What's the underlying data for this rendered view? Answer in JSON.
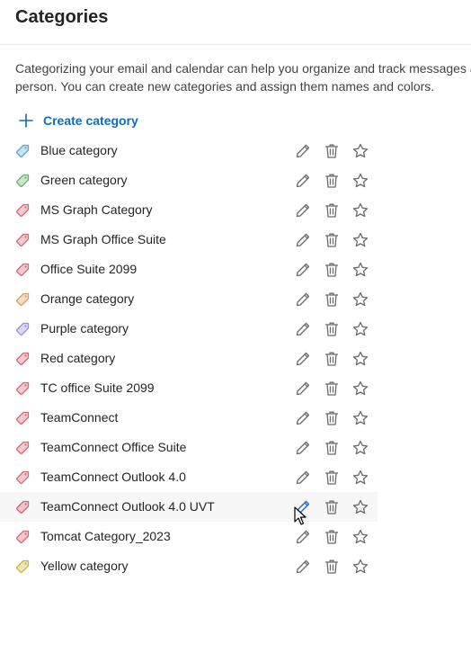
{
  "header": {
    "title": "Categories"
  },
  "description": {
    "line1": "Categorizing your email and calendar can help you organize and track messages a",
    "line2": "person. You can create new categories and assign them names and colors."
  },
  "create": {
    "label": "Create category",
    "icon": "plus-icon"
  },
  "colors": {
    "accent": "#0f6cbd",
    "icon_gray": "#6b6b6b",
    "edit_active": "#0f6cbd"
  },
  "categories": [
    {
      "name": "Blue category",
      "color": "#5fa8d3"
    },
    {
      "name": "Green category",
      "color": "#6bb36b"
    },
    {
      "name": "MS Graph Category",
      "color": "#d9667a"
    },
    {
      "name": "MS Graph Office Suite",
      "color": "#d9667a"
    },
    {
      "name": "Office Suite 2099",
      "color": "#d9667a"
    },
    {
      "name": "Orange category",
      "color": "#e59a5c"
    },
    {
      "name": "Purple category",
      "color": "#9b8fe0"
    },
    {
      "name": "Red category",
      "color": "#d9667a"
    },
    {
      "name": "TC office Suite 2099",
      "color": "#d9667a"
    },
    {
      "name": "TeamConnect",
      "color": "#d9667a"
    },
    {
      "name": "TeamConnect Office Suite",
      "color": "#d9667a"
    },
    {
      "name": "TeamConnect Outlook 4.0",
      "color": "#d9667a"
    },
    {
      "name": "TeamConnect Outlook 4.0 UVT",
      "color": "#d9667a",
      "hovered": true
    },
    {
      "name": "Tomcat Category_2023",
      "color": "#d9667a"
    },
    {
      "name": "Yellow category",
      "color": "#c9b640"
    }
  ],
  "row_actions": {
    "edit_icon": "pencil-icon",
    "delete_icon": "trash-icon",
    "favorite_icon": "star-icon"
  }
}
